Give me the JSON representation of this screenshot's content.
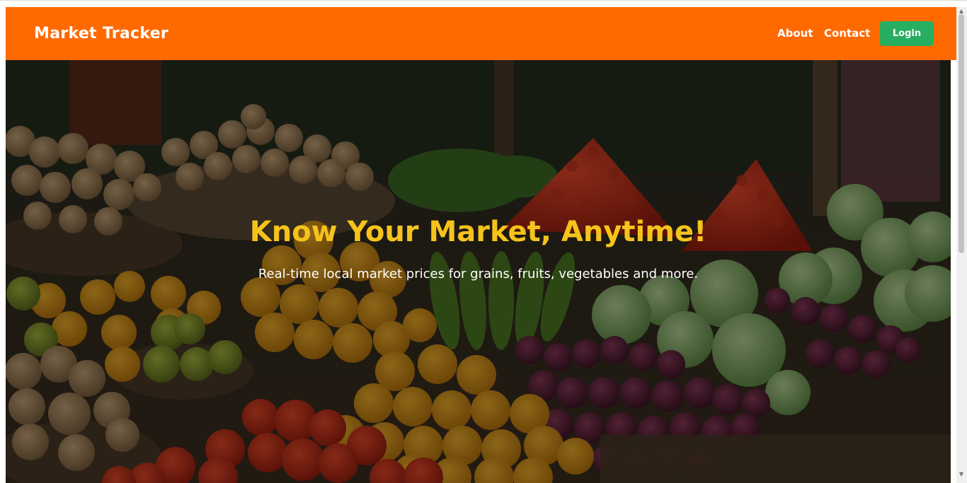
{
  "navbar": {
    "brand": "Market Tracker",
    "links": [
      {
        "label": "About"
      },
      {
        "label": "Contact"
      }
    ],
    "login_label": "Login",
    "bg_color": "#ff6a00",
    "login_color": "#27ae60"
  },
  "hero": {
    "title": "Know Your Market, Anytime!",
    "subtitle": "Real-time local market prices for grains, fruits, vegetables and more.",
    "title_color": "#f5c31c",
    "background_image": "market-produce-photo"
  },
  "scrollbar": {
    "up_icon": "scroll-up-arrow-icon",
    "down_icon": "scroll-down-arrow-icon"
  }
}
